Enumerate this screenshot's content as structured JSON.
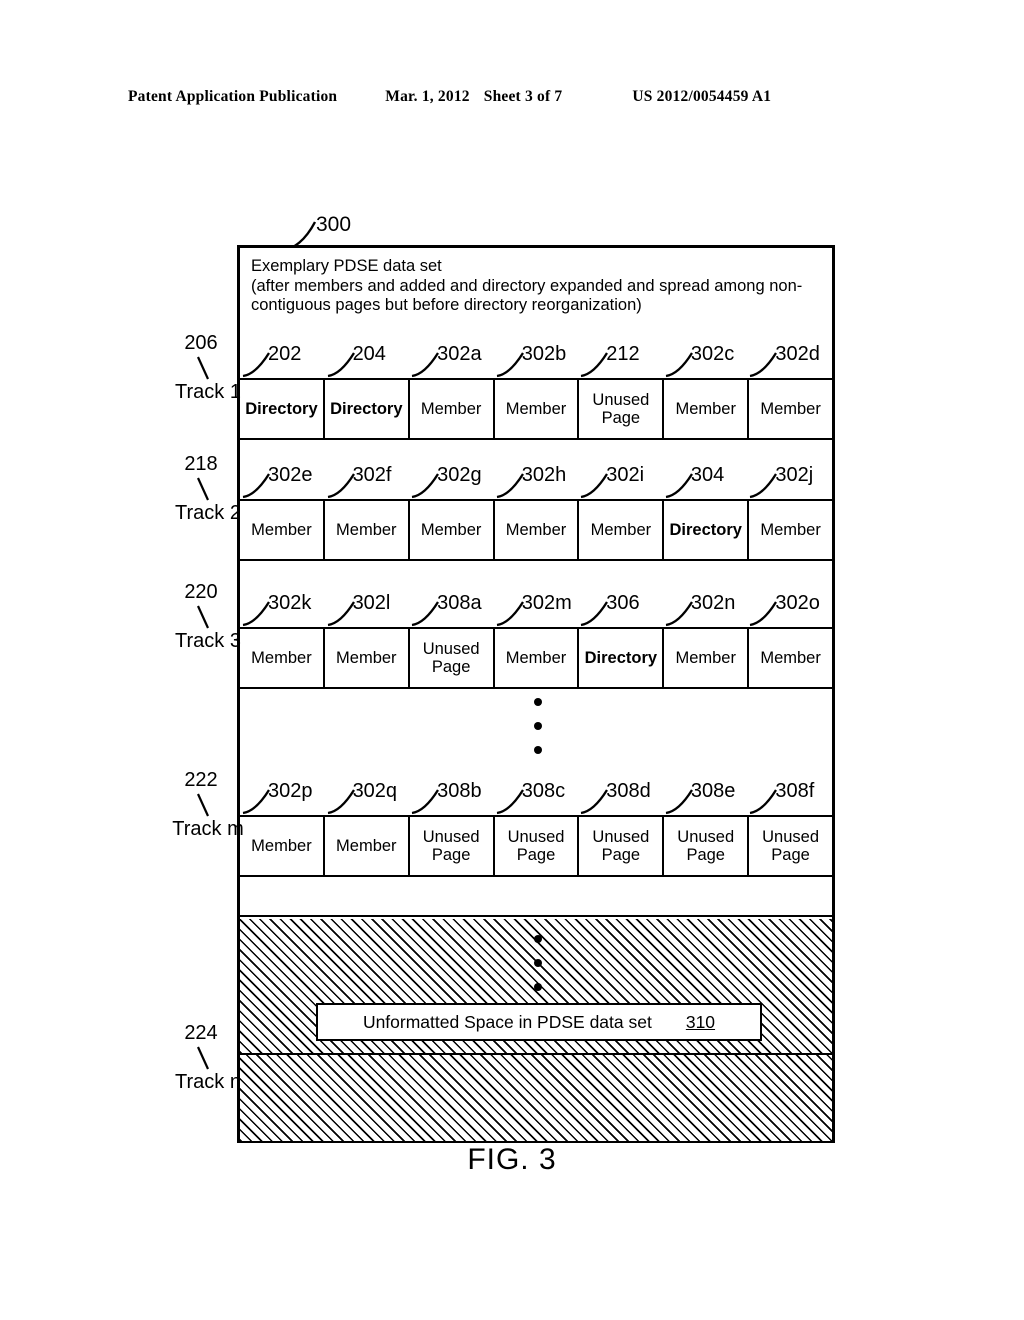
{
  "page_header": {
    "publication": "Patent Application Publication",
    "date": "Mar. 1, 2012",
    "sheet": "Sheet 3 of 7",
    "patent_number": "US 2012/0054459 A1"
  },
  "figure": {
    "callout": "300",
    "title": "Exemplary PDSE data set\n(after members and added and directory expanded and spread among non-\ncontiguous pages but before directory reorganization)",
    "caption": "FIG. 3",
    "tracks": [
      {
        "ref": "206",
        "name": "Track 1",
        "refs": [
          "202",
          "204",
          "302a",
          "302b",
          "212",
          "302c",
          "302d"
        ],
        "cells": [
          {
            "label": "Directory",
            "bold": true
          },
          {
            "label": "Directory",
            "bold": true
          },
          {
            "label": "Member",
            "bold": false
          },
          {
            "label": "Member",
            "bold": false
          },
          {
            "label": "Unused\nPage",
            "bold": false
          },
          {
            "label": "Member",
            "bold": false
          },
          {
            "label": "Member",
            "bold": false
          }
        ]
      },
      {
        "ref": "218",
        "name": "Track 2",
        "refs": [
          "302e",
          "302f",
          "302g",
          "302h",
          "302i",
          "304",
          "302j"
        ],
        "cells": [
          {
            "label": "Member",
            "bold": false
          },
          {
            "label": "Member",
            "bold": false
          },
          {
            "label": "Member",
            "bold": false
          },
          {
            "label": "Member",
            "bold": false
          },
          {
            "label": "Member",
            "bold": false
          },
          {
            "label": "Directory",
            "bold": true
          },
          {
            "label": "Member",
            "bold": false
          }
        ]
      },
      {
        "ref": "220",
        "name": "Track 3",
        "refs": [
          "302k",
          "302l",
          "308a",
          "302m",
          "306",
          "302n",
          "302o"
        ],
        "cells": [
          {
            "label": "Member",
            "bold": false
          },
          {
            "label": "Member",
            "bold": false
          },
          {
            "label": "Unused\nPage",
            "bold": false
          },
          {
            "label": "Member",
            "bold": false
          },
          {
            "label": "Directory",
            "bold": true
          },
          {
            "label": "Member",
            "bold": false
          },
          {
            "label": "Member",
            "bold": false
          }
        ]
      },
      {
        "ref": "222",
        "name": "Track m",
        "refs": [
          "302p",
          "302q",
          "308b",
          "308c",
          "308d",
          "308e",
          "308f"
        ],
        "cells": [
          {
            "label": "Member",
            "bold": false
          },
          {
            "label": "Member",
            "bold": false
          },
          {
            "label": "Unused\nPage",
            "bold": false
          },
          {
            "label": "Unused\nPage",
            "bold": false
          },
          {
            "label": "Unused\nPage",
            "bold": false
          },
          {
            "label": "Unused\nPage",
            "bold": false
          },
          {
            "label": "Unused\nPage",
            "bold": false
          }
        ]
      }
    ],
    "last_track": {
      "ref": "224",
      "name": "Track n"
    },
    "unformatted": {
      "text": "Unformatted Space in PDSE data set",
      "ref": "310"
    }
  }
}
